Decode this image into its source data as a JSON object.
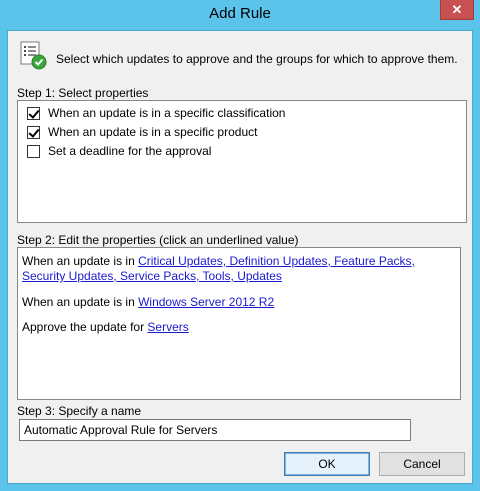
{
  "window": {
    "title": "Add Rule",
    "close_glyph": "✕"
  },
  "header": {
    "instruction": "Select which updates to approve and the groups for which to approve them.",
    "icon": "checklist-approve-icon"
  },
  "step1": {
    "label": "Step 1: Select properties",
    "options": [
      {
        "label": "When an update is in a specific classification",
        "checked": true
      },
      {
        "label": "When an update is in a specific product",
        "checked": true
      },
      {
        "label": "Set a deadline for the approval",
        "checked": false
      }
    ]
  },
  "step2": {
    "label": "Step 2: Edit the properties (click an underlined value)",
    "line1_prefix": "When an update is in ",
    "line1_link_a": "Critical Updates, Definition Updates, Feature Packs,",
    "line1_link_b": "Security Updates, Service Packs, Tools, Updates",
    "line2_prefix": "When an update is in ",
    "line2_link": "Windows Server 2012 R2",
    "line3_prefix": "Approve the update for ",
    "line3_link": "Servers"
  },
  "step3": {
    "label": "Step 3: Specify a name",
    "name_value": "Automatic Approval Rule for Servers"
  },
  "buttons": {
    "ok": "OK",
    "cancel": "Cancel"
  },
  "colors": {
    "frame": "#5cc4ea",
    "client": "#f0f0f0",
    "link": "#1a1acf",
    "close": "#c75050"
  }
}
